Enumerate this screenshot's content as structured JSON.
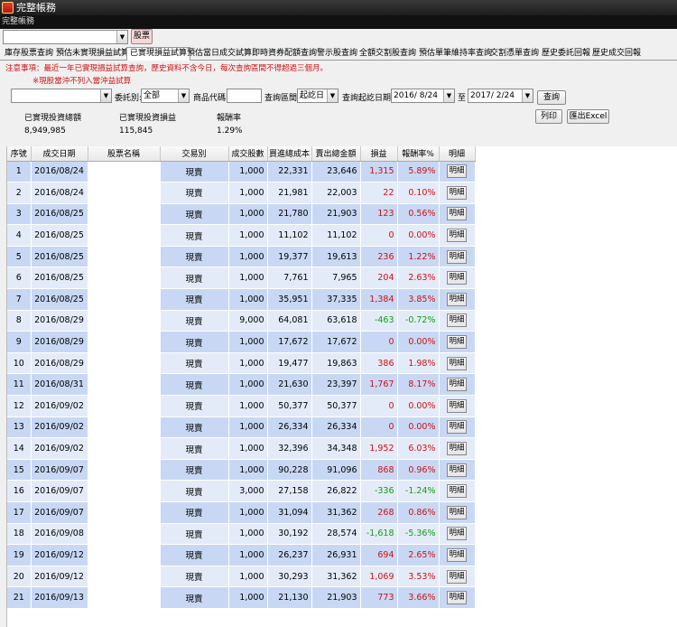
{
  "window": {
    "title": "完整帳務",
    "subtitle": "完整帳務"
  },
  "topbar": {
    "account_value": "",
    "stock_button": "股票"
  },
  "tabs": [
    "庫存股票查詢",
    "預估未實現損益試算",
    "已實現損益試算",
    "預估當日成交試算",
    "即時資券配額查詢",
    "警示股查詢",
    "全額交割股查詢",
    "預估單筆維持率查詢",
    "交割憑單查詢",
    "歷史委託回報",
    "歷史成交回報"
  ],
  "active_tab": 2,
  "notices": {
    "line1": "注意事項：最近一年已實現損益試算查詢，歷史資料不含今日，每次查詢區間不得超過三個月。",
    "line2": "※現股當沖不列入當沖益試算"
  },
  "filters": {
    "commission_label": "委託別:",
    "commission_value": "全部",
    "product_code_label": "商品代碼:",
    "product_code_value": "",
    "query_range_label": "查詢區間:",
    "query_range_value": "起訖日",
    "date_range_label": "查詢起訖日期:",
    "start_date": "2016/ 8/24",
    "to_label": "至",
    "end_date": "2017/ 2/24",
    "query_button": "查詢",
    "print_button": "列印",
    "export_button": "匯出Excel"
  },
  "summary": {
    "amount_label": "已實現投資總額",
    "amount_value": "8,949,985",
    "profit_label": "已實現投資損益",
    "profit_value": "115,845",
    "rate_label": "報酬率",
    "rate_value": "1.29%"
  },
  "table": {
    "headers": [
      "序號",
      "成交日期",
      "股票名稱",
      "交易別",
      "成交股數",
      "買進總成本",
      "賣出總金額",
      "損益",
      "報酬率%",
      "明細"
    ],
    "detail_label": "明細",
    "rows": [
      [
        "1",
        "2016/08/24",
        "",
        "現賣",
        "1,000",
        "22,331",
        "23,646",
        "1,315",
        "5.89%"
      ],
      [
        "2",
        "2016/08/24",
        "",
        "現賣",
        "1,000",
        "21,981",
        "22,003",
        "22",
        "0.10%"
      ],
      [
        "3",
        "2016/08/25",
        "",
        "現賣",
        "1,000",
        "21,780",
        "21,903",
        "123",
        "0.56%"
      ],
      [
        "4",
        "2016/08/25",
        "",
        "現賣",
        "1,000",
        "11,102",
        "11,102",
        "0",
        "0.00%"
      ],
      [
        "5",
        "2016/08/25",
        "",
        "現賣",
        "1,000",
        "19,377",
        "19,613",
        "236",
        "1.22%"
      ],
      [
        "6",
        "2016/08/25",
        "",
        "現賣",
        "1,000",
        "7,761",
        "7,965",
        "204",
        "2.63%"
      ],
      [
        "7",
        "2016/08/25",
        "",
        "現賣",
        "1,000",
        "35,951",
        "37,335",
        "1,384",
        "3.85%"
      ],
      [
        "8",
        "2016/08/29",
        "",
        "現賣",
        "9,000",
        "64,081",
        "63,618",
        "-463",
        "-0.72%"
      ],
      [
        "9",
        "2016/08/29",
        "",
        "現賣",
        "1,000",
        "17,672",
        "17,672",
        "0",
        "0.00%"
      ],
      [
        "10",
        "2016/08/29",
        "",
        "現賣",
        "1,000",
        "19,477",
        "19,863",
        "386",
        "1.98%"
      ],
      [
        "11",
        "2016/08/31",
        "",
        "現賣",
        "1,000",
        "21,630",
        "23,397",
        "1,767",
        "8.17%"
      ],
      [
        "12",
        "2016/09/02",
        "",
        "現賣",
        "1,000",
        "50,377",
        "50,377",
        "0",
        "0.00%"
      ],
      [
        "13",
        "2016/09/02",
        "",
        "現賣",
        "1,000",
        "26,334",
        "26,334",
        "0",
        "0.00%"
      ],
      [
        "14",
        "2016/09/02",
        "",
        "現賣",
        "1,000",
        "32,396",
        "34,348",
        "1,952",
        "6.03%"
      ],
      [
        "15",
        "2016/09/07",
        "",
        "現賣",
        "1,000",
        "90,228",
        "91,096",
        "868",
        "0.96%"
      ],
      [
        "16",
        "2016/09/07",
        "",
        "現賣",
        "3,000",
        "27,158",
        "26,822",
        "-336",
        "-1.24%"
      ],
      [
        "17",
        "2016/09/07",
        "",
        "現賣",
        "1,000",
        "31,094",
        "31,362",
        "268",
        "0.86%"
      ],
      [
        "18",
        "2016/09/08",
        "",
        "現賣",
        "1,000",
        "30,192",
        "28,574",
        "-1,618",
        "-5.36%"
      ],
      [
        "19",
        "2016/09/12",
        "",
        "現賣",
        "1,000",
        "26,237",
        "26,931",
        "694",
        "2.65%"
      ],
      [
        "20",
        "2016/09/12",
        "",
        "現賣",
        "1,000",
        "30,293",
        "31,362",
        "1,069",
        "3.53%"
      ],
      [
        "21",
        "2016/09/13",
        "",
        "現賣",
        "1,000",
        "21,130",
        "21,903",
        "773",
        "3.66%"
      ]
    ]
  },
  "colors": {
    "row_odd": "#c8d8f4",
    "row_even": "#e4ebf8",
    "profit": "#d01010",
    "loss": "#10a010",
    "notice": "#d01010"
  }
}
